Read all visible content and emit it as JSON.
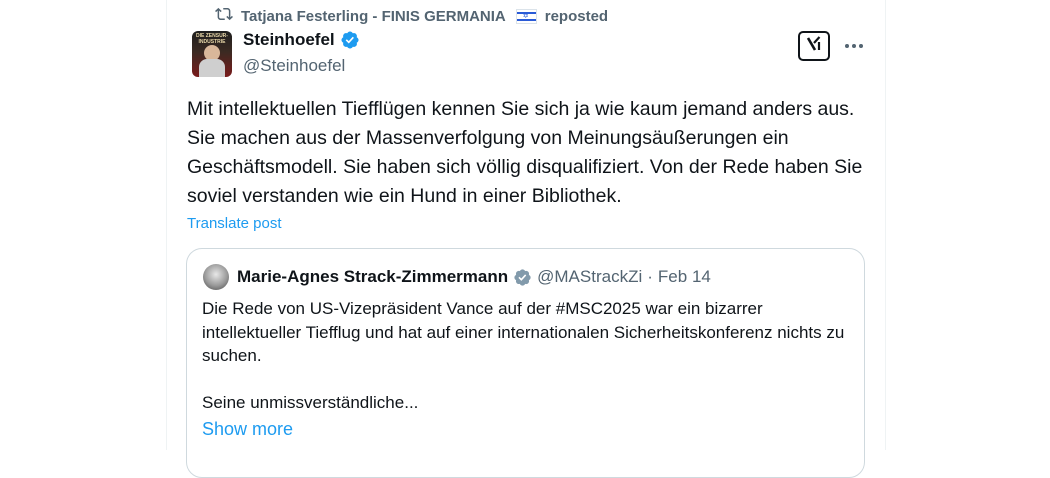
{
  "repost": {
    "icon": "repost-icon",
    "reposter": "Tatjana Festerling - FINIS GERMANIA",
    "flag": "israel-flag",
    "action": "reposted"
  },
  "post": {
    "display_name": "Steinhoefel",
    "handle": "@Steinhoefel",
    "verified": true,
    "avatar_text": "DIE ZENSUR-INDUSTRIE",
    "text": "Mit intellektuellen Tiefflügen kennen Sie sich ja wie kaum jemand anders aus. Sie machen aus der Massenverfolgung von Meinungsäußerungen ein Geschäftsmodell. Sie haben sich völlig disqualifiziert. Von der Rede haben Sie soviel verstanden wie ein Hund in einer Bibliothek.",
    "translate_label": "Translate post",
    "grok_icon": "grok-icon",
    "more_icon": "more-icon"
  },
  "quote": {
    "display_name": "Marie-Agnes Strack-Zimmermann",
    "handle": "@MAStrackZi",
    "separator": "·",
    "date": "Feb 14",
    "verified": true,
    "verified_color": "#829aab",
    "text": "Die Rede von US-Vizepräsident Vance auf der #MSC2025 war ein bizarrer intellektueller Tiefflug und hat auf einer internationalen Sicherheitskonferenz nichts zu suchen.\n\nSeine unmissverständliche...",
    "show_more_label": "Show more"
  },
  "colors": {
    "text": "#0f1419",
    "secondary": "#536471",
    "link": "#1d9bf0",
    "verified_blue": "#1d9bf0",
    "border": "#cfd9de"
  }
}
